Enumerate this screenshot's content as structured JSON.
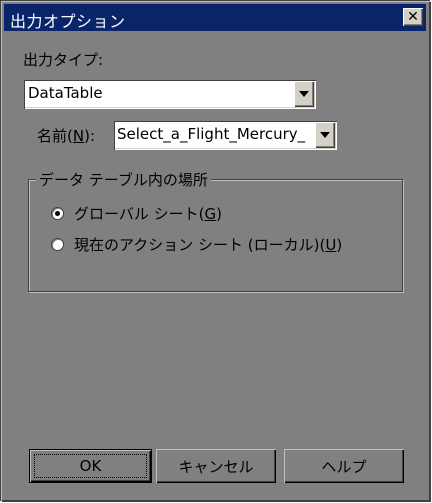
{
  "window": {
    "title": "出力オプション",
    "close_glyph": "✕"
  },
  "output_type": {
    "label": "出力タイプ:",
    "value": "DataTable"
  },
  "name": {
    "label_prefix": "名前(",
    "label_key": "N",
    "label_suffix": "):",
    "value": "Select_a_Flight_Mercury_"
  },
  "location_group": {
    "label": "データ テーブル内の場所",
    "options": [
      {
        "prefix": "グローバル シート(",
        "key": "G",
        "suffix": ")",
        "selected": true
      },
      {
        "prefix": "現在のアクション シート (ローカル)(",
        "key": "U",
        "suffix": ")",
        "selected": false
      }
    ]
  },
  "buttons": {
    "ok": "OK",
    "cancel": "キャンセル",
    "help": "ヘルプ"
  },
  "colors": {
    "titlebar": "#0a246a",
    "dialog_bg": "#808080"
  },
  "icons": {
    "close": "close-icon",
    "dropdown": "chevron-down-icon"
  }
}
